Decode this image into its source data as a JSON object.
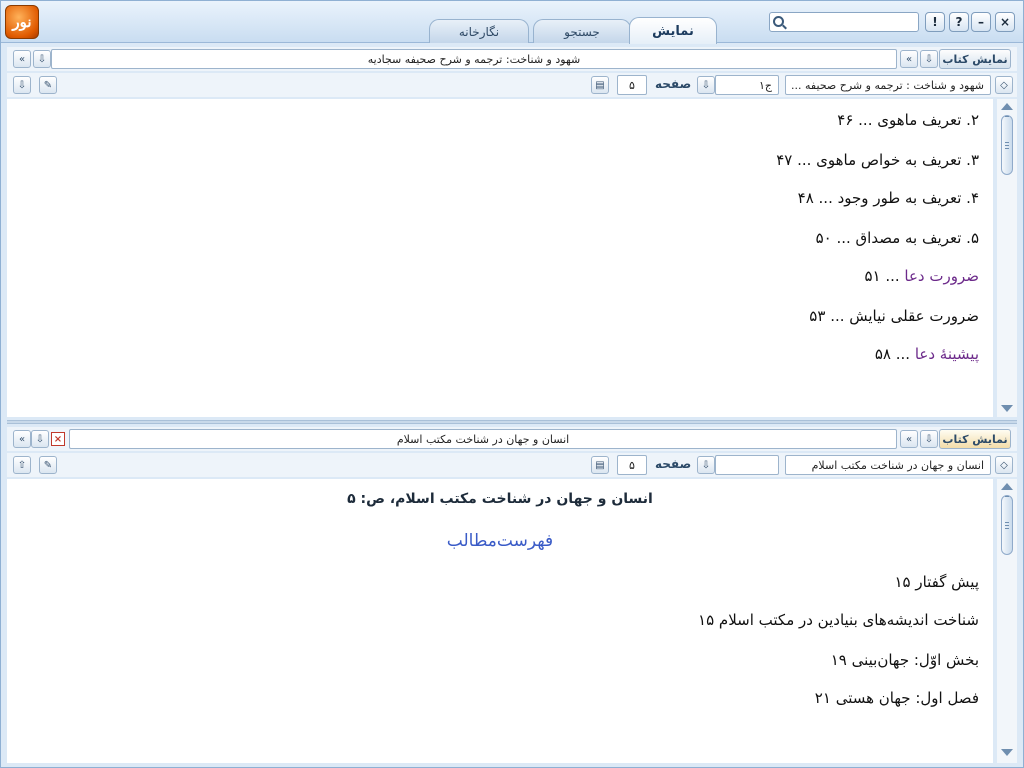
{
  "tabs": [
    {
      "label": "نمایش"
    },
    {
      "label": "جستجو"
    },
    {
      "label": "نگارخانه"
    }
  ],
  "logo_text": "نور",
  "window_buttons": {
    "close": "×",
    "minimize": "–",
    "help": "?",
    "info": "!"
  },
  "search": {
    "value": "",
    "placeholder": ""
  },
  "top_pane": {
    "show_book_label": "نمایش کتاب",
    "book_title": "شهود و شناخت: ترجمه و شرح صحیفه سجادیه",
    "book_combo": "شهود و شناخت : ترجمه و شرح صحیفه ...",
    "volume_value": "ج۱",
    "page_label": "صفحه",
    "page_value": "۵",
    "nav_prev": "«",
    "lines": [
      {
        "text": "۲. تعریف ماهوی ... ۴۶",
        "purple": ""
      },
      {
        "text": "۳. تعریف به خواص ماهوی ... ۴۷",
        "purple": ""
      },
      {
        "text": "۴. تعریف به طور وجود ... ۴۸",
        "purple": ""
      },
      {
        "text": "۵. تعریف به مصداق ... ۵۰",
        "purple": ""
      },
      {
        "purple": "ضرورت دعا",
        "text": " ... ۵۱"
      },
      {
        "text": "ضرورت عقلی نیایش ... ۵۳",
        "purple": ""
      },
      {
        "purple": "پیشینهٔ دعا",
        "text": " ... ۵۸"
      }
    ]
  },
  "bottom_pane": {
    "show_book_label": "نمایش کتاب",
    "book_title": "انسان و جهان در شناخت مکتب اسلام",
    "book_combo": "انسان و جهان در شناخت مکتب اسلام",
    "volume_value": "",
    "page_label": "صفحه",
    "page_value": "۵",
    "nav_prev": "«",
    "close_mark": "×",
    "heading": "انسان و جهان در شناخت مکتب اسلام، ص: ۵",
    "toc_title": "فهرست‌مطالب",
    "lines": [
      {
        "text": "پیش گفتار ۱۵"
      },
      {
        "text": "شناخت اندیشه‌های بنیادین در مکتب اسلام ۱۵"
      },
      {
        "text": "بخش اوّل: جهان‌بینی ۱۹"
      },
      {
        "text": "فصل اول: جهان هستی ۲۱"
      }
    ]
  },
  "colors": {
    "accent": "#1c3b5e",
    "purple_link": "#6c2a8a",
    "toc_blue": "#3a5bc7"
  }
}
